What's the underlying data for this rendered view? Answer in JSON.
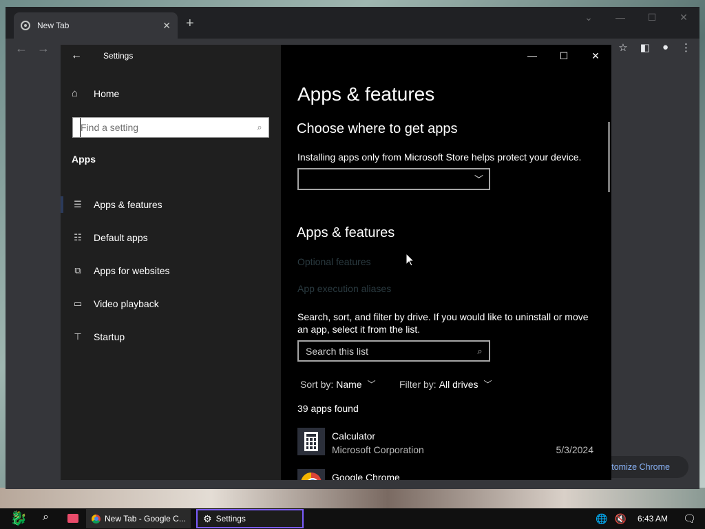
{
  "chrome": {
    "tab_title": "New Tab",
    "tab_close": "✕",
    "new_tab": "+",
    "customize_label": "stomize Chrome"
  },
  "settings": {
    "title": "Settings",
    "home_label": "Home",
    "search_placeholder": "Find a setting",
    "section_label": "Apps",
    "nav": [
      {
        "label": "Apps & features",
        "icon": "list-icon"
      },
      {
        "label": "Default apps",
        "icon": "default-apps-icon"
      },
      {
        "label": "Apps for websites",
        "icon": "open-in-app-icon"
      },
      {
        "label": "Video playback",
        "icon": "video-icon"
      },
      {
        "label": "Startup",
        "icon": "startup-icon"
      }
    ],
    "page_title": "Apps & features",
    "choose_heading": "Choose where to get apps",
    "choose_desc": "Installing apps only from Microsoft Store helps protect your device.",
    "dropdown_value": "",
    "features_heading": "Apps & features",
    "optional_features": "Optional features",
    "execution_aliases": "App execution aliases",
    "list_desc": "Search, sort, and filter by drive. If you would like to uninstall or move an app, select it from the list.",
    "list_search_placeholder": "Search this list",
    "sort_label": "Sort by:",
    "sort_value": "Name",
    "filter_label": "Filter by:",
    "filter_value": "All drives",
    "apps_found": "39 apps found",
    "apps": [
      {
        "name": "Calculator",
        "publisher": "Microsoft Corporation",
        "date": "5/3/2024"
      },
      {
        "name": "Google Chrome",
        "publisher": "",
        "date": ""
      }
    ]
  },
  "taskbar": {
    "chrome_item": "New Tab - Google C...",
    "settings_item": "Settings",
    "clock": "6:43 AM"
  },
  "colors": {
    "accent": "#7b5cff",
    "link_disabled": "#2a3a40",
    "chrome_link": "#8ab4f8"
  }
}
